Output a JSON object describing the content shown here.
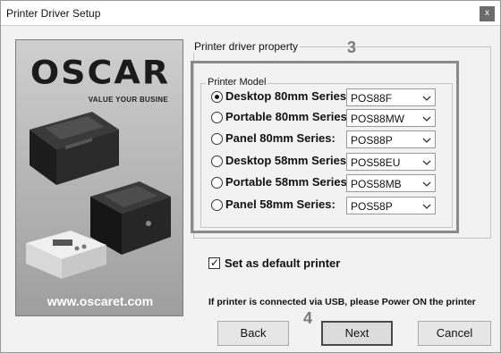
{
  "window": {
    "title": "Printer Driver Setup",
    "close_glyph": "x"
  },
  "banner": {
    "logo": "OSCAR",
    "tagline": "VALUE YOUR BUSINE",
    "website": "www.oscaret.com"
  },
  "property_group": {
    "label": "Printer driver property"
  },
  "model_group": {
    "label": "Printer Model"
  },
  "models": [
    {
      "label": "Desktop 80mm Series:",
      "value": "POS88F",
      "checked": true
    },
    {
      "label": "Portable 80mm Series:",
      "value": "POS88MW",
      "checked": false
    },
    {
      "label": "Panel 80mm Series:",
      "value": "POS88P",
      "checked": false
    },
    {
      "label": "Desktop 58mm Series:",
      "value": "POS58EU",
      "checked": false
    },
    {
      "label": "Portable 58mm Series:",
      "value": "POS58MB",
      "checked": false
    },
    {
      "label": "Panel 58mm Series:",
      "value": "POS58P",
      "checked": false
    }
  ],
  "callouts": {
    "step3": "3",
    "step4": "4"
  },
  "default_printer": {
    "label": "Set as default printer",
    "checked": true
  },
  "usb_note": "If printer is connected via USB, please Power ON the printer",
  "buttons": {
    "back": "Back",
    "next": "Next",
    "cancel": "Cancel"
  }
}
